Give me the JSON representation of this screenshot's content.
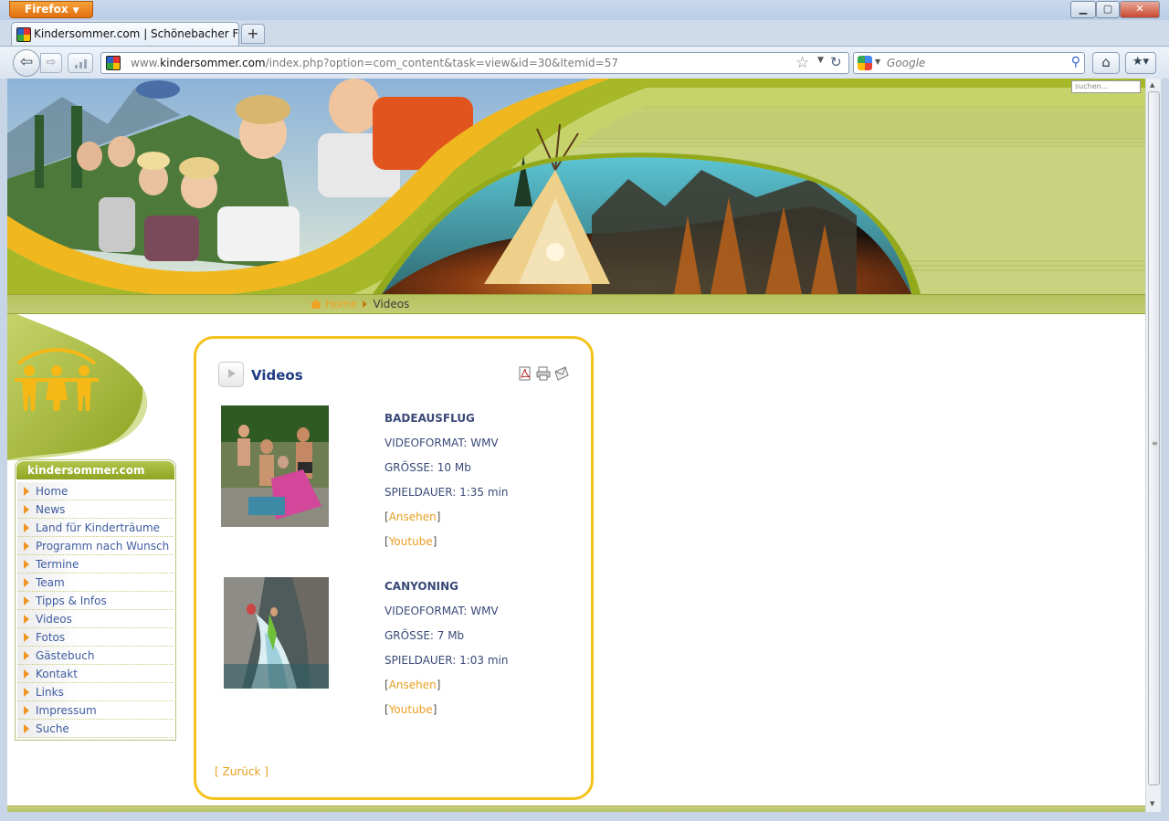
{
  "browser": {
    "app_button_label": "Firefox",
    "tab_title": "Kindersommer.com | Schönebacher Feri...",
    "new_tab_label": "+",
    "url_prefix": "www.",
    "url_host": "kindersommer.com",
    "url_path": "/index.php?option=com_content&task=view&id=30&Itemid=57",
    "search_placeholder": "Google"
  },
  "site": {
    "search_placeholder": "suchen...",
    "breadcrumb": {
      "home": "Home",
      "current": "Videos"
    },
    "menu": {
      "title": "kindersommer.com",
      "items": [
        "Home",
        "News",
        "Land für Kinderträume",
        "Programm nach Wunsch",
        "Termine",
        "Team",
        "Tipps & Infos",
        "Videos",
        "Fotos",
        "Gästebuch",
        "Kontakt",
        "Links",
        "Impressum",
        "Suche"
      ]
    },
    "article": {
      "title": "Videos",
      "back_link": "[ Zurück ]",
      "videos": [
        {
          "name": "BADEAUSFLUG",
          "format": "VIDEOFORMAT: WMV",
          "size": "GRÖSSE: 10 Mb",
          "duration": "SPIELDAUER: 1:35 min",
          "watch_label": "Ansehen",
          "youtube_label": "Youtube"
        },
        {
          "name": "CANYONING",
          "format": "VIDEOFORMAT: WMV",
          "size": "GRÖSSE: 7 Mb",
          "duration": "SPIELDAUER: 1:03 min",
          "watch_label": "Ansehen",
          "youtube_label": "Youtube"
        }
      ]
    }
  },
  "colors": {
    "accent_orange": "#e99f22",
    "frame_yellow": "#f4c21d",
    "header_green": "#9fb033",
    "title_blue": "#1e3c82",
    "menu_link_blue": "#3d5ba0"
  }
}
